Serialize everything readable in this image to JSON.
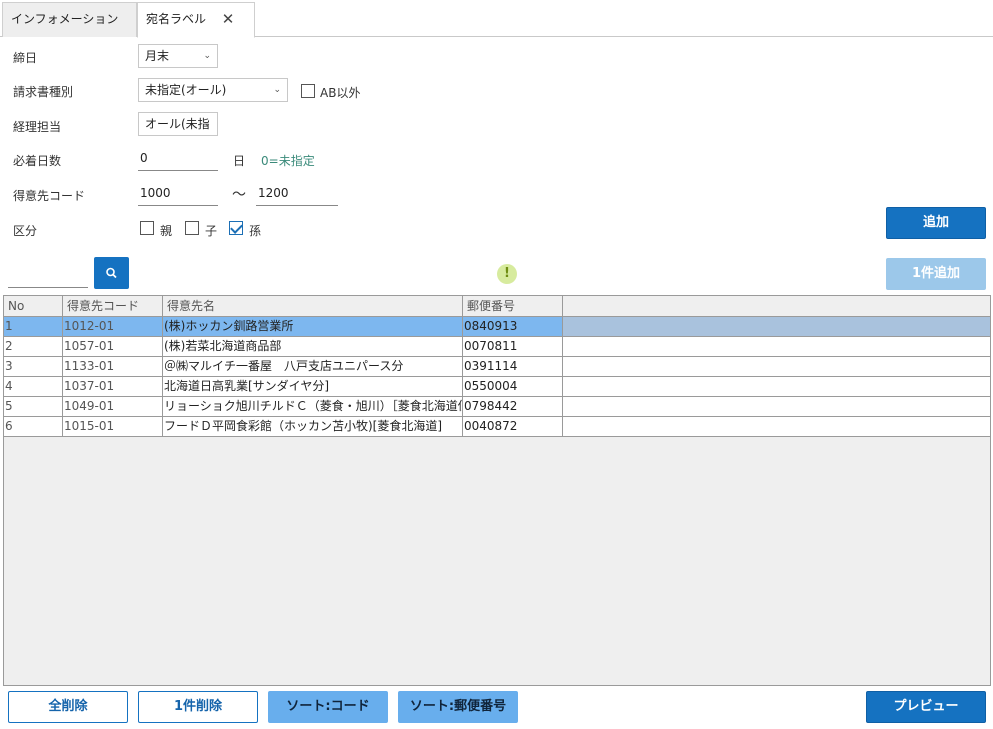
{
  "tabs": [
    {
      "label": "インフォメーション",
      "active": false
    },
    {
      "label": "宛名ラベル",
      "active": true
    }
  ],
  "form": {
    "shimebi_label": "締日",
    "shimebi_value": "月末",
    "seikyusho_label": "請求書種別",
    "seikyusho_value": "未指定(オール)",
    "ab_label": "AB以外",
    "ab_checked": false,
    "keiri_label": "経理担当",
    "keiri_value": "オール(未指",
    "hicchaku_label": "必着日数",
    "hicchaku_value": "0",
    "hicchaku_unit": "日",
    "hicchaku_hint": "0=未指定",
    "tokuisaki_label": "得意先コード",
    "tokuisaki_from": "1000",
    "tokuisaki_tilde": "〜",
    "tokuisaki_to": "1200",
    "kubun_label": "区分",
    "kubun": [
      {
        "label": "親",
        "checked": false
      },
      {
        "label": "子",
        "checked": false
      },
      {
        "label": "孫",
        "checked": true
      }
    ]
  },
  "buttons": {
    "add": "追加",
    "add_one": "1件追加",
    "delete_all": "全削除",
    "delete_one": "1件削除",
    "sort_code": "ソート:コード",
    "sort_zip": "ソート:郵便番号",
    "preview": "プレビュー"
  },
  "search": {
    "value": ""
  },
  "warning_icon": "!",
  "grid": {
    "columns": [
      "No",
      "得意先コード",
      "得意先名",
      "郵便番号"
    ],
    "rows": [
      {
        "no": "1",
        "code": "1012-01",
        "name": "(株)ホッカン釧路営業所",
        "zip": "0840913",
        "selected": true
      },
      {
        "no": "2",
        "code": "1057-01",
        "name": "(株)若菜北海道商品部",
        "zip": "0070811",
        "selected": false
      },
      {
        "no": "3",
        "code": "1133-01",
        "name": "＠㈱マルイチ一番屋　八戸支店ユニパース分",
        "zip": "0391114",
        "selected": false
      },
      {
        "no": "4",
        "code": "1037-01",
        "name": "北海道日高乳業[サンダイヤ分]",
        "zip": "0550004",
        "selected": false
      },
      {
        "no": "5",
        "code": "1049-01",
        "name": "リョーショク旭川チルドＣ（菱食・旭川）［菱食北海道低温]",
        "zip": "0798442",
        "selected": false
      },
      {
        "no": "6",
        "code": "1015-01",
        "name": "フードＤ平岡食彩館（ホッカン苫小牧)[菱食北海道]",
        "zip": "0040872",
        "selected": false
      }
    ]
  }
}
